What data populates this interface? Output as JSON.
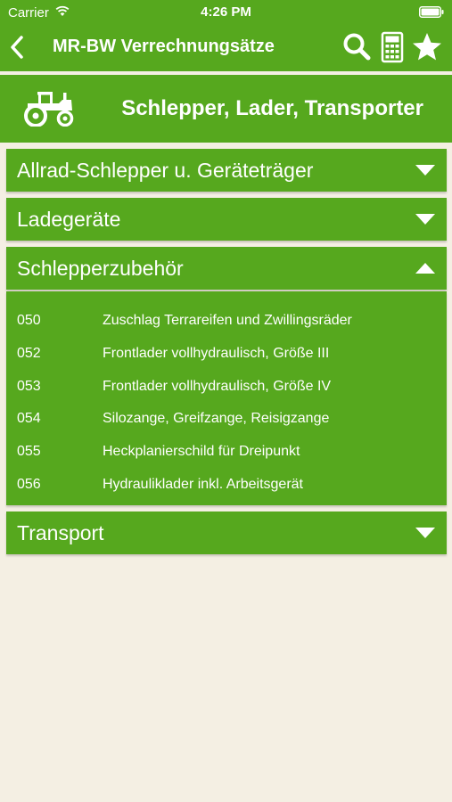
{
  "status": {
    "carrier": "Carrier",
    "time": "4:26 PM"
  },
  "nav": {
    "title": "MR-BW Verrechnungsätze"
  },
  "category": {
    "title": "Schlepper, Lader, Transporter"
  },
  "colors": {
    "accent": "#56a81e",
    "background": "#f4efe3"
  },
  "sections": [
    {
      "label": "Allrad-Schlepper u. Geräteträger",
      "expanded": false
    },
    {
      "label": "Ladegeräte",
      "expanded": false
    },
    {
      "label": "Schlepperzubehör",
      "expanded": true
    },
    {
      "label": "Transport",
      "expanded": false
    }
  ],
  "items": [
    {
      "code": "050",
      "text": "Zuschlag Terrareifen und Zwillingsräder"
    },
    {
      "code": "052",
      "text": "Frontlader vollhydraulisch, Größe III"
    },
    {
      "code": "053",
      "text": "Frontlader vollhydraulisch, Größe IV"
    },
    {
      "code": "054",
      "text": "Silozange, Greifzange, Reisigzange"
    },
    {
      "code": "055",
      "text": "Heckplanierschild für Dreipunkt"
    },
    {
      "code": "056",
      "text": "Hydrauliklader inkl. Arbeitsgerät"
    }
  ],
  "icons": {
    "back": "chevron-left-icon",
    "search": "search-icon",
    "calculator": "calculator-icon",
    "favorite": "star-icon",
    "category": "tractor-icon"
  }
}
